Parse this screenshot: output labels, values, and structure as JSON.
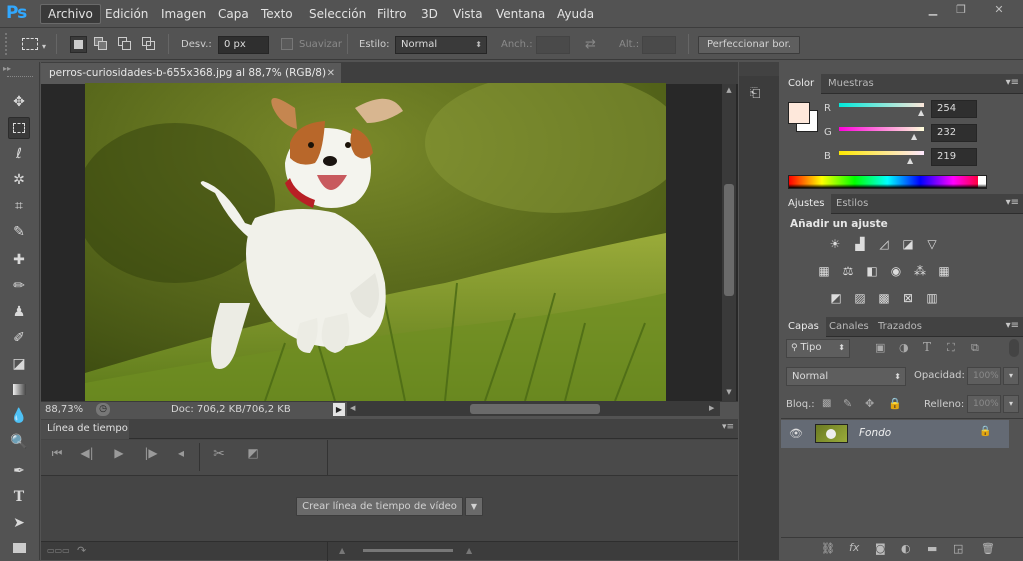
{
  "app": {
    "logo": "Ps"
  },
  "menu": [
    "Archivo",
    "Edición",
    "Imagen",
    "Capa",
    "Texto",
    "Selección",
    "Filtro",
    "3D",
    "Vista",
    "Ventana",
    "Ayuda"
  ],
  "options": {
    "desv_label": "Desv.:",
    "desv_value": "0 px",
    "suavizar": "Suavizar",
    "estilo_label": "Estilo:",
    "estilo_value": "Normal",
    "anch_label": "Anch.:",
    "alt_label": "Alt.:",
    "refine": "Perfeccionar bor."
  },
  "document": {
    "tab_title": "perros-curiosidades-b-655x368.jpg al 88,7% (RGB/8)",
    "zoom": "88,73%",
    "doc_info": "Doc: 706,2 KB/706,2 KB"
  },
  "timeline": {
    "tab": "Línea de tiempo",
    "create_button": "Crear línea de tiempo de vídeo"
  },
  "color_panel": {
    "tabs": [
      "Color",
      "Muestras"
    ],
    "r_label": "R",
    "g_label": "G",
    "b_label": "B",
    "r": "254",
    "g": "232",
    "b": "219",
    "fg": "#fee8db"
  },
  "adjust_panel": {
    "tabs": [
      "Ajustes",
      "Estilos"
    ],
    "heading": "Añadir un ajuste"
  },
  "layers_panel": {
    "tabs": [
      "Capas",
      "Canales",
      "Trazados"
    ],
    "filter": "Tipo",
    "blend": "Normal",
    "opacity_label": "Opacidad:",
    "opacity": "100%",
    "lock_label": "Bloq.:",
    "fill_label": "Relleno:",
    "fill": "100%",
    "layer_name": "Fondo"
  }
}
